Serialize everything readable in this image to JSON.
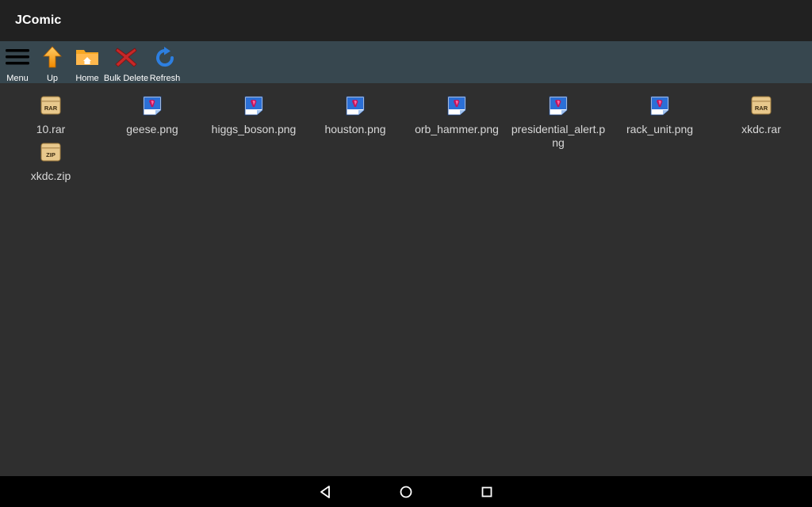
{
  "app": {
    "title": "JComic"
  },
  "toolbar": {
    "menu_label": "Menu",
    "up_label": "Up",
    "home_label": "Home",
    "bulk_delete_label": "Bulk Delete",
    "refresh_label": "Refresh"
  },
  "files": [
    {
      "name": "10.rar",
      "type": "rar"
    },
    {
      "name": "geese.png",
      "type": "image"
    },
    {
      "name": "higgs_boson.png",
      "type": "image"
    },
    {
      "name": "houston.png",
      "type": "image"
    },
    {
      "name": "orb_hammer.png",
      "type": "image"
    },
    {
      "name": "presidential_alert.png",
      "type": "image"
    },
    {
      "name": "rack_unit.png",
      "type": "image"
    },
    {
      "name": "xkdc.rar",
      "type": "rar"
    },
    {
      "name": "xkdc.zip",
      "type": "zip"
    }
  ],
  "archive_labels": {
    "rar": "RAR",
    "zip": "ZIP"
  },
  "colors": {
    "appbar": "#212121",
    "toolbar": "#37474f",
    "background": "#2f2f2f",
    "navbar": "#000000"
  }
}
